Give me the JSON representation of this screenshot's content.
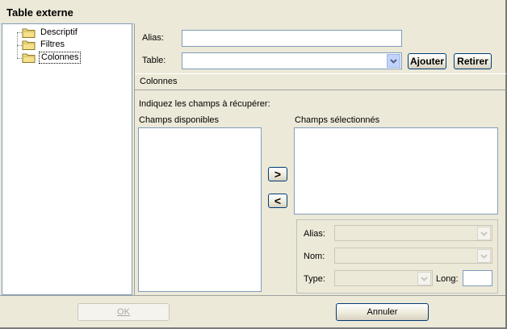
{
  "window": {
    "title": "Table externe"
  },
  "tree": {
    "items": [
      {
        "label": "Descriptif",
        "selected": false
      },
      {
        "label": "Filtres",
        "selected": false
      },
      {
        "label": "Colonnes",
        "selected": true
      }
    ]
  },
  "form": {
    "alias_label": "Alias:",
    "alias_value": "",
    "table_label": "Table:",
    "table_value": "",
    "add_button": "Ajouter",
    "remove_button": "Retirer"
  },
  "section": {
    "title": "Colonnes"
  },
  "columns": {
    "instruction": "Indiquez les champs à récupérer:",
    "available_label": "Champs disponibles",
    "selected_label": "Champs sélectionnés",
    "add_arrow": ">",
    "remove_arrow": "<",
    "available_items": [],
    "selected_items": []
  },
  "properties": {
    "alias_label": "Alias:",
    "name_label": "Nom:",
    "type_label": "Type:",
    "long_label": "Long:",
    "long_value": ""
  },
  "footer": {
    "ok_button": "OK",
    "cancel_button": "Annuler"
  },
  "colors": {
    "accent_border": "#7f9db9",
    "button_border": "#003c74",
    "dialog_bg": "#ece9d8"
  }
}
